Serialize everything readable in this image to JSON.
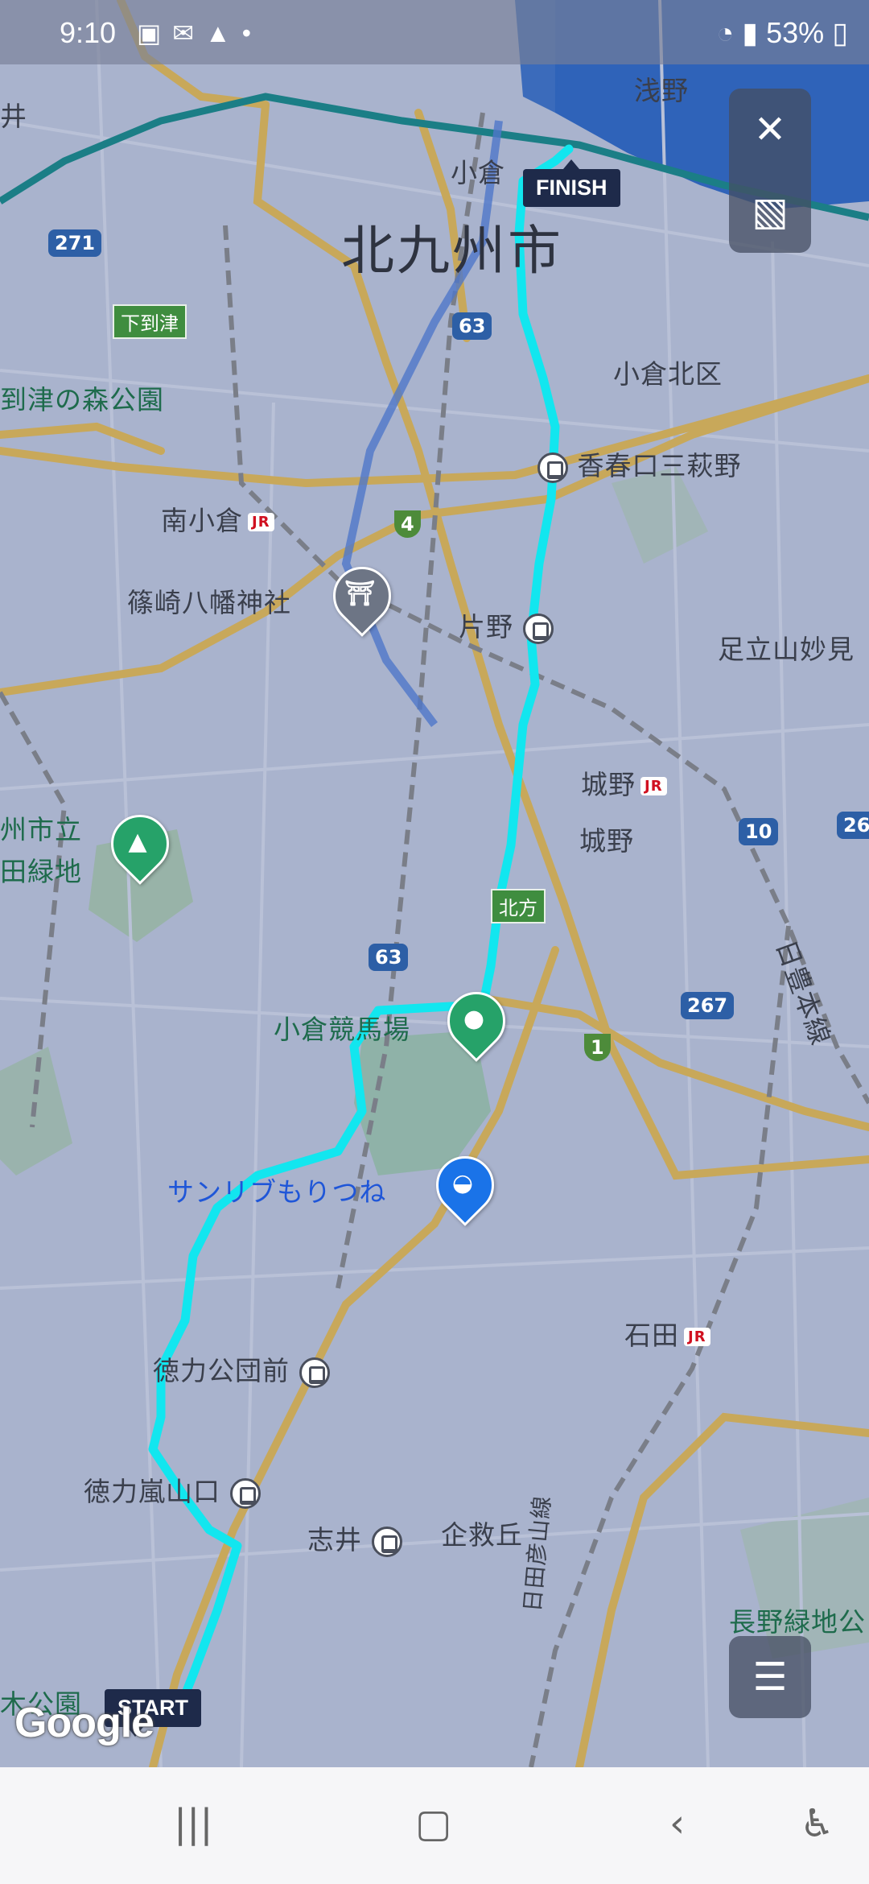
{
  "status_bar": {
    "time": "9:10",
    "left_icons": [
      "image-icon",
      "mail-icon",
      "signal-triangle-icon",
      "dot-icon"
    ],
    "battery": "53%"
  },
  "map": {
    "city_label": "北九州市",
    "labels": {
      "asano": "浅野",
      "kokura": "小倉",
      "kokura_kita": "小倉北区",
      "shimoitozu_forest": "到津の森公園",
      "shimoitozu_sign": "下到津",
      "kasugaguchi": "香春口三萩野",
      "minami_kokura": "南小倉",
      "shinozaki": "篠崎八幡神社",
      "katano": "片野",
      "adachiyama": "足立山妙見",
      "kitakyushu_park1": "州市立",
      "kitakyushu_park2": "田緑地",
      "jono_station": "城野",
      "jono_area": "城野",
      "kitagata_sign": "北方",
      "racecourse": "小倉競馬場",
      "sunlive": "サンリブもりつね",
      "hitoyo": "日豊本線",
      "ishida": "石田",
      "tokuriki_danchi": "徳力公団前",
      "tokuriki_arashiyama": "徳力嵐山口",
      "shii": "志井",
      "kigukaoka": "企救丘",
      "hitahiko": "日田彦山線",
      "nagano_park": "長野緑地公",
      "bottom_park": "木公園",
      "ii": "井"
    },
    "shields": {
      "r271": "271",
      "r63a": "63",
      "r4": "4",
      "r10": "10",
      "r26": "26",
      "r63b": "63",
      "r267": "267",
      "r1": "1"
    },
    "jr_badge": "JR",
    "finish_label": "FINISH",
    "start_label": "START",
    "attribution": "Google"
  },
  "controls": {
    "close_icon": "close-icon",
    "gallery_icon": "image-icon",
    "settings_icon": "sliders-icon"
  },
  "nav_bar": {
    "items": [
      "recent-apps-icon",
      "home-icon",
      "back-icon",
      "accessibility-icon"
    ]
  },
  "colors": {
    "route": "#12e6ef",
    "map_bg": "#a9b3cd",
    "major_road": "#c8a85a",
    "rail": "#7a7e88"
  }
}
